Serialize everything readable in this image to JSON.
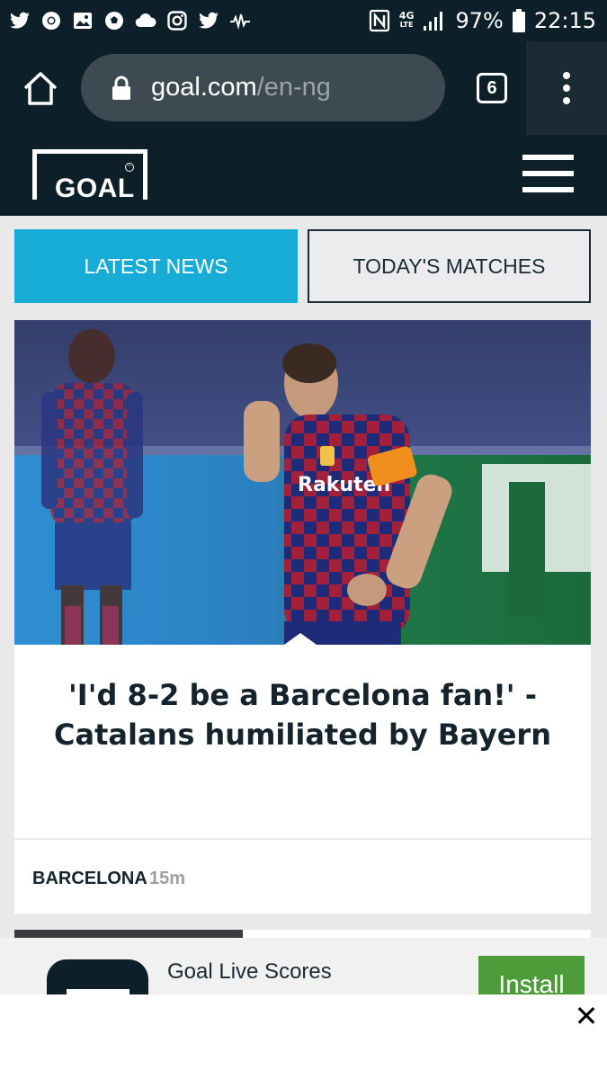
{
  "status_bar": {
    "battery": "97%",
    "time": "22:15",
    "network": "4G",
    "network_sub": "LTE",
    "icons": [
      "twitter-icon",
      "chrome-icon",
      "gallery-icon",
      "soccer-ball-icon",
      "cloud-icon",
      "instagram-icon",
      "twitter-icon",
      "audio-wave-icon"
    ]
  },
  "browser": {
    "url_domain": "goal.com",
    "url_path": "/en-ng",
    "tab_count": "6"
  },
  "site": {
    "logo": "GOAL"
  },
  "tabs": {
    "latest": "LATEST NEWS",
    "today": "TODAY'S MATCHES"
  },
  "article": {
    "headline": "'I'd 8-2 be a Barcelona fan!' - Catalans humiliated by Bayern",
    "tag": "BARCELONA",
    "time": "15m",
    "jersey_sponsor": "Rakuten"
  },
  "app_banner": {
    "name": "Goal Live Scores",
    "install": "Install"
  },
  "colors": {
    "dark": "#0d1f29",
    "accent": "#17acd6",
    "install": "#4d9c3a"
  }
}
